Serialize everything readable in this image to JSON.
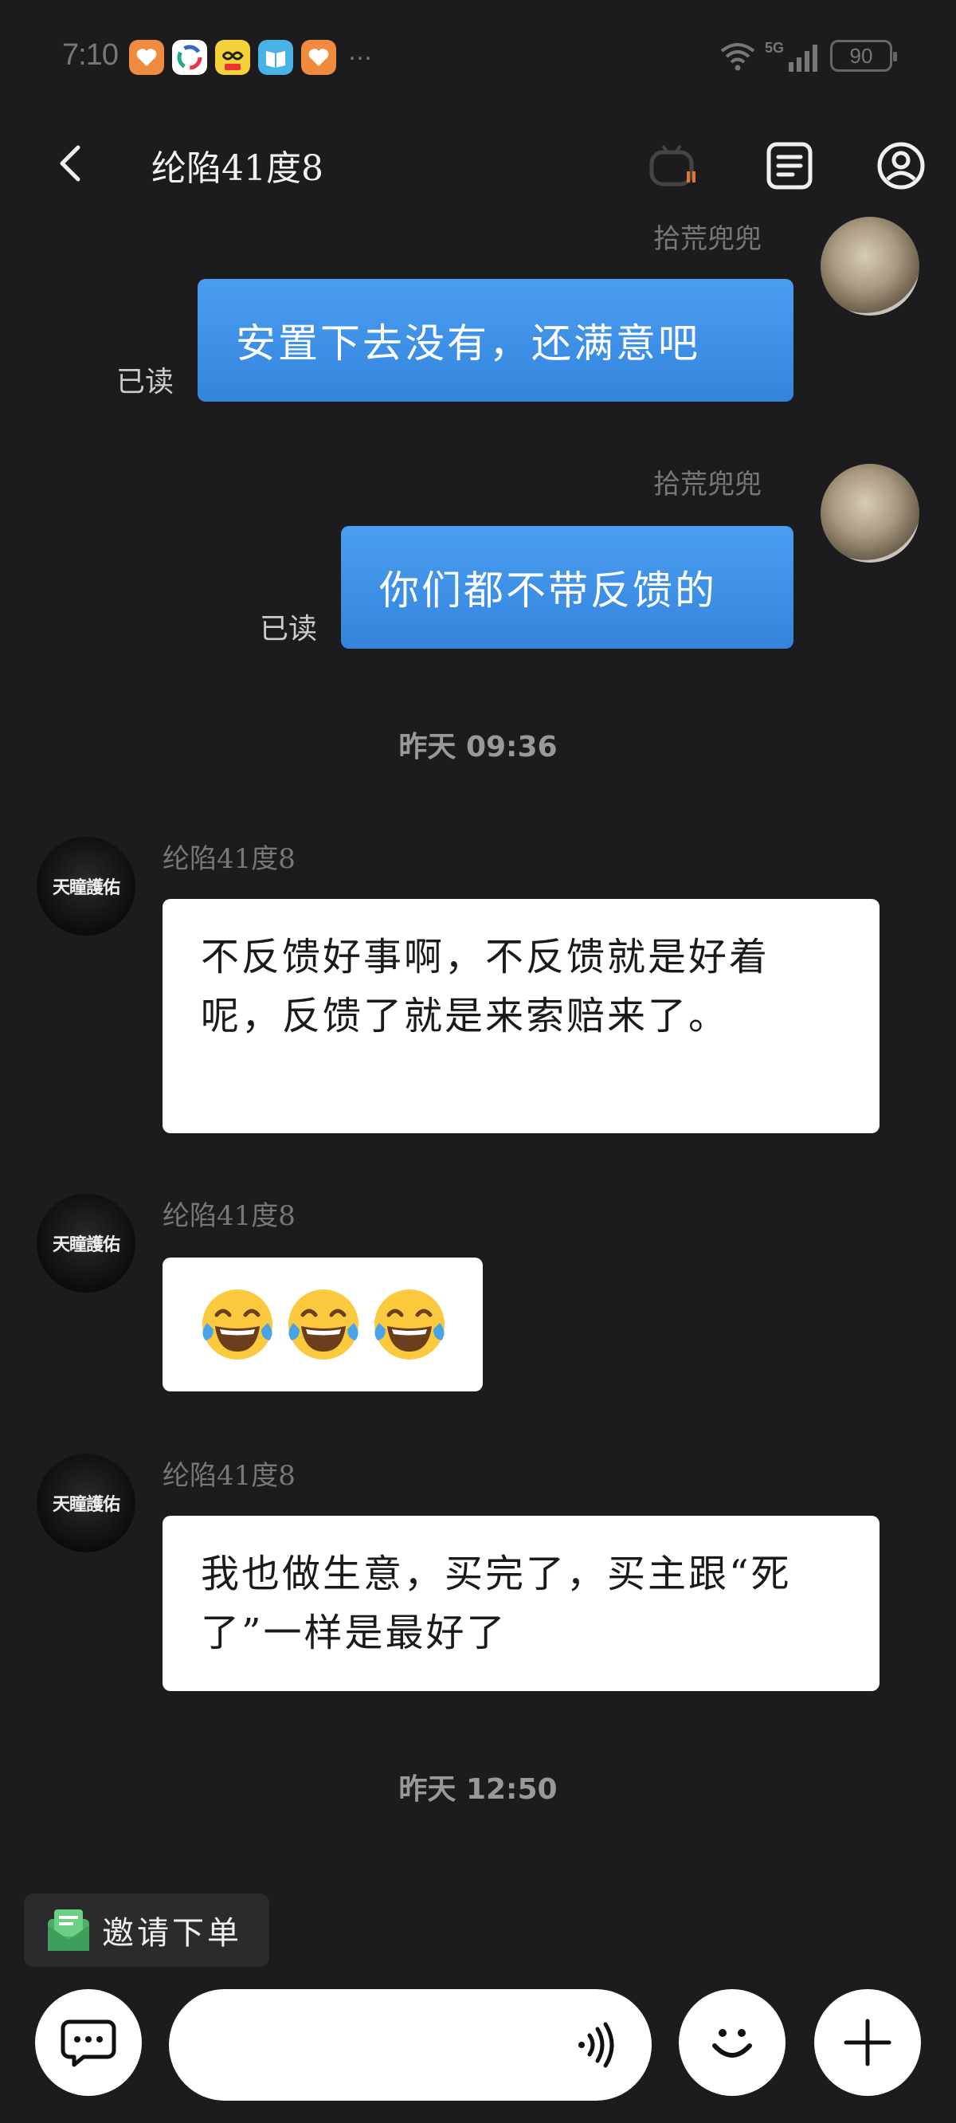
{
  "status_bar": {
    "time": "7:10",
    "battery": "90",
    "app_icons": [
      "heart-app-icon",
      "colorful-app-icon",
      "yellow-app-icon",
      "book-app-icon",
      "heart-app-icon"
    ],
    "more": "…"
  },
  "header": {
    "title": "纶陷41度8",
    "icons": [
      "back-icon",
      "robot-icon",
      "order-list-icon",
      "profile-icon"
    ]
  },
  "messages": [
    {
      "type": "out",
      "sender": "拾荒兜兜",
      "text": "安置下去没有，还满意吧",
      "status": "已读"
    },
    {
      "type": "out",
      "sender": "拾荒兜兜",
      "text": "你们都不带反馈的",
      "status": "已读"
    },
    {
      "type": "time",
      "text": "昨天 09:36"
    },
    {
      "type": "in",
      "sender": "纶陷41度8",
      "text": "不反馈好事啊，不反馈就是好着呢，反馈了就是来索赔来了。"
    },
    {
      "type": "in",
      "sender": "纶陷41度8",
      "emoji": "tears-of-joy-emoji",
      "emoji_count": 3
    },
    {
      "type": "in",
      "sender": "纶陷41度8",
      "text": "我也做生意，买完了，买主跟“死了”一样是最好了"
    },
    {
      "type": "time",
      "text": "昨天 12:50"
    }
  ],
  "avatars": {
    "other_text": "天瞳護佑"
  },
  "invite": {
    "label": "邀请下单"
  },
  "input": {
    "placeholder": ""
  },
  "colors": {
    "background": "#1c1c1e",
    "bubble_out": "#3b8fe6",
    "bubble_in": "#ffffff"
  }
}
